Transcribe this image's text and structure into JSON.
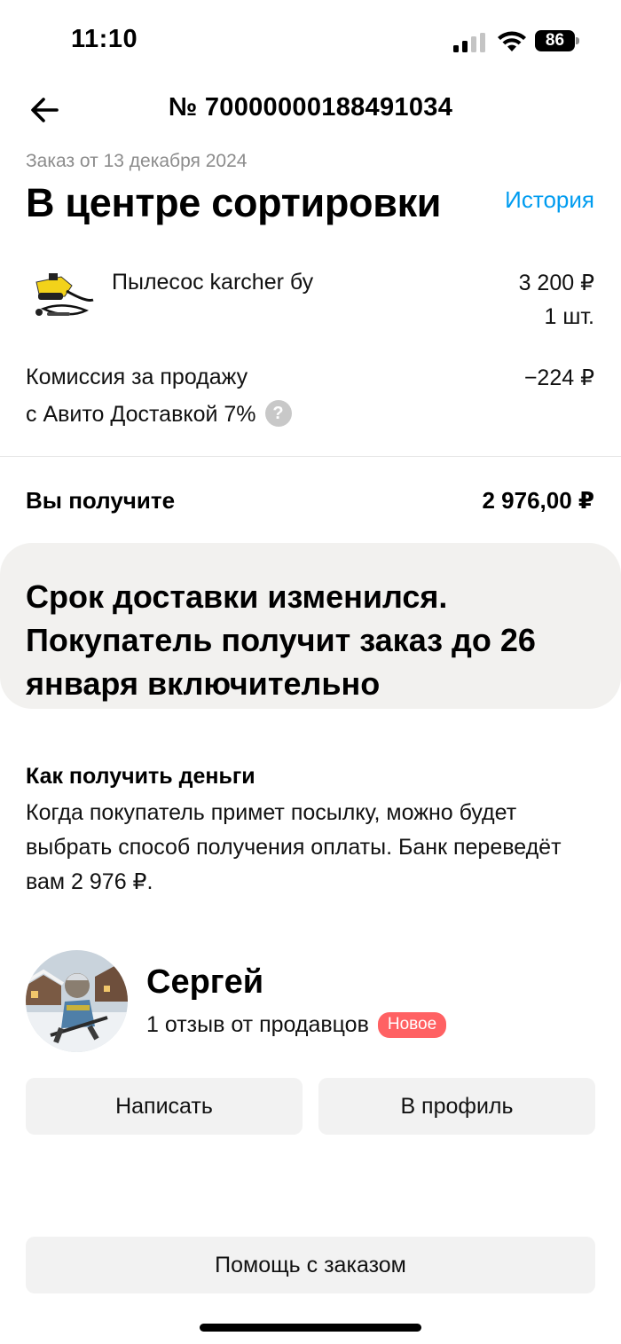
{
  "status_bar": {
    "time": "11:10",
    "battery_level": "86",
    "icons": [
      "signal-icon",
      "wifi-icon",
      "battery-icon"
    ]
  },
  "header": {
    "back_icon": "arrow-left-icon",
    "order_number": "№ 70000000188491034"
  },
  "order": {
    "date": "Заказ от 13 декабря 2024",
    "status": "В центре сортировки",
    "history_link": "История"
  },
  "item": {
    "thumbnail_icon": "karcher-vacuum-photo",
    "name": "Пылесос karcher бу",
    "price": "3 200 ₽",
    "quantity": "1 шт."
  },
  "commission": {
    "label_line1": "Комиссия за продажу",
    "label_line2": "с Авито Доставкой 7%",
    "help_icon": "?",
    "value": "−224 ₽"
  },
  "total": {
    "label": "Вы получите",
    "value": "2 976,00 ₽"
  },
  "notice": {
    "text": "Срок доставки изменился. Покупатель получит заказ до 26 января включительно"
  },
  "money": {
    "title": "Как получить деньги",
    "text": "Когда покупатель примет посылку, можно будет выбрать способ получения оплаты. Банк переведёт вам 2 976 ₽."
  },
  "seller": {
    "name": "Сергей",
    "reviews": "1 отзыв от продавцов",
    "badge": "Новое"
  },
  "buttons": {
    "write": "Написать",
    "profile": "В профиль",
    "help": "Помощь с заказом"
  },
  "colors": {
    "accent_link": "#009cf0",
    "badge_new": "#ff6163",
    "notice_bg": "#f2f1ef",
    "button_bg": "#f2f2f2"
  }
}
